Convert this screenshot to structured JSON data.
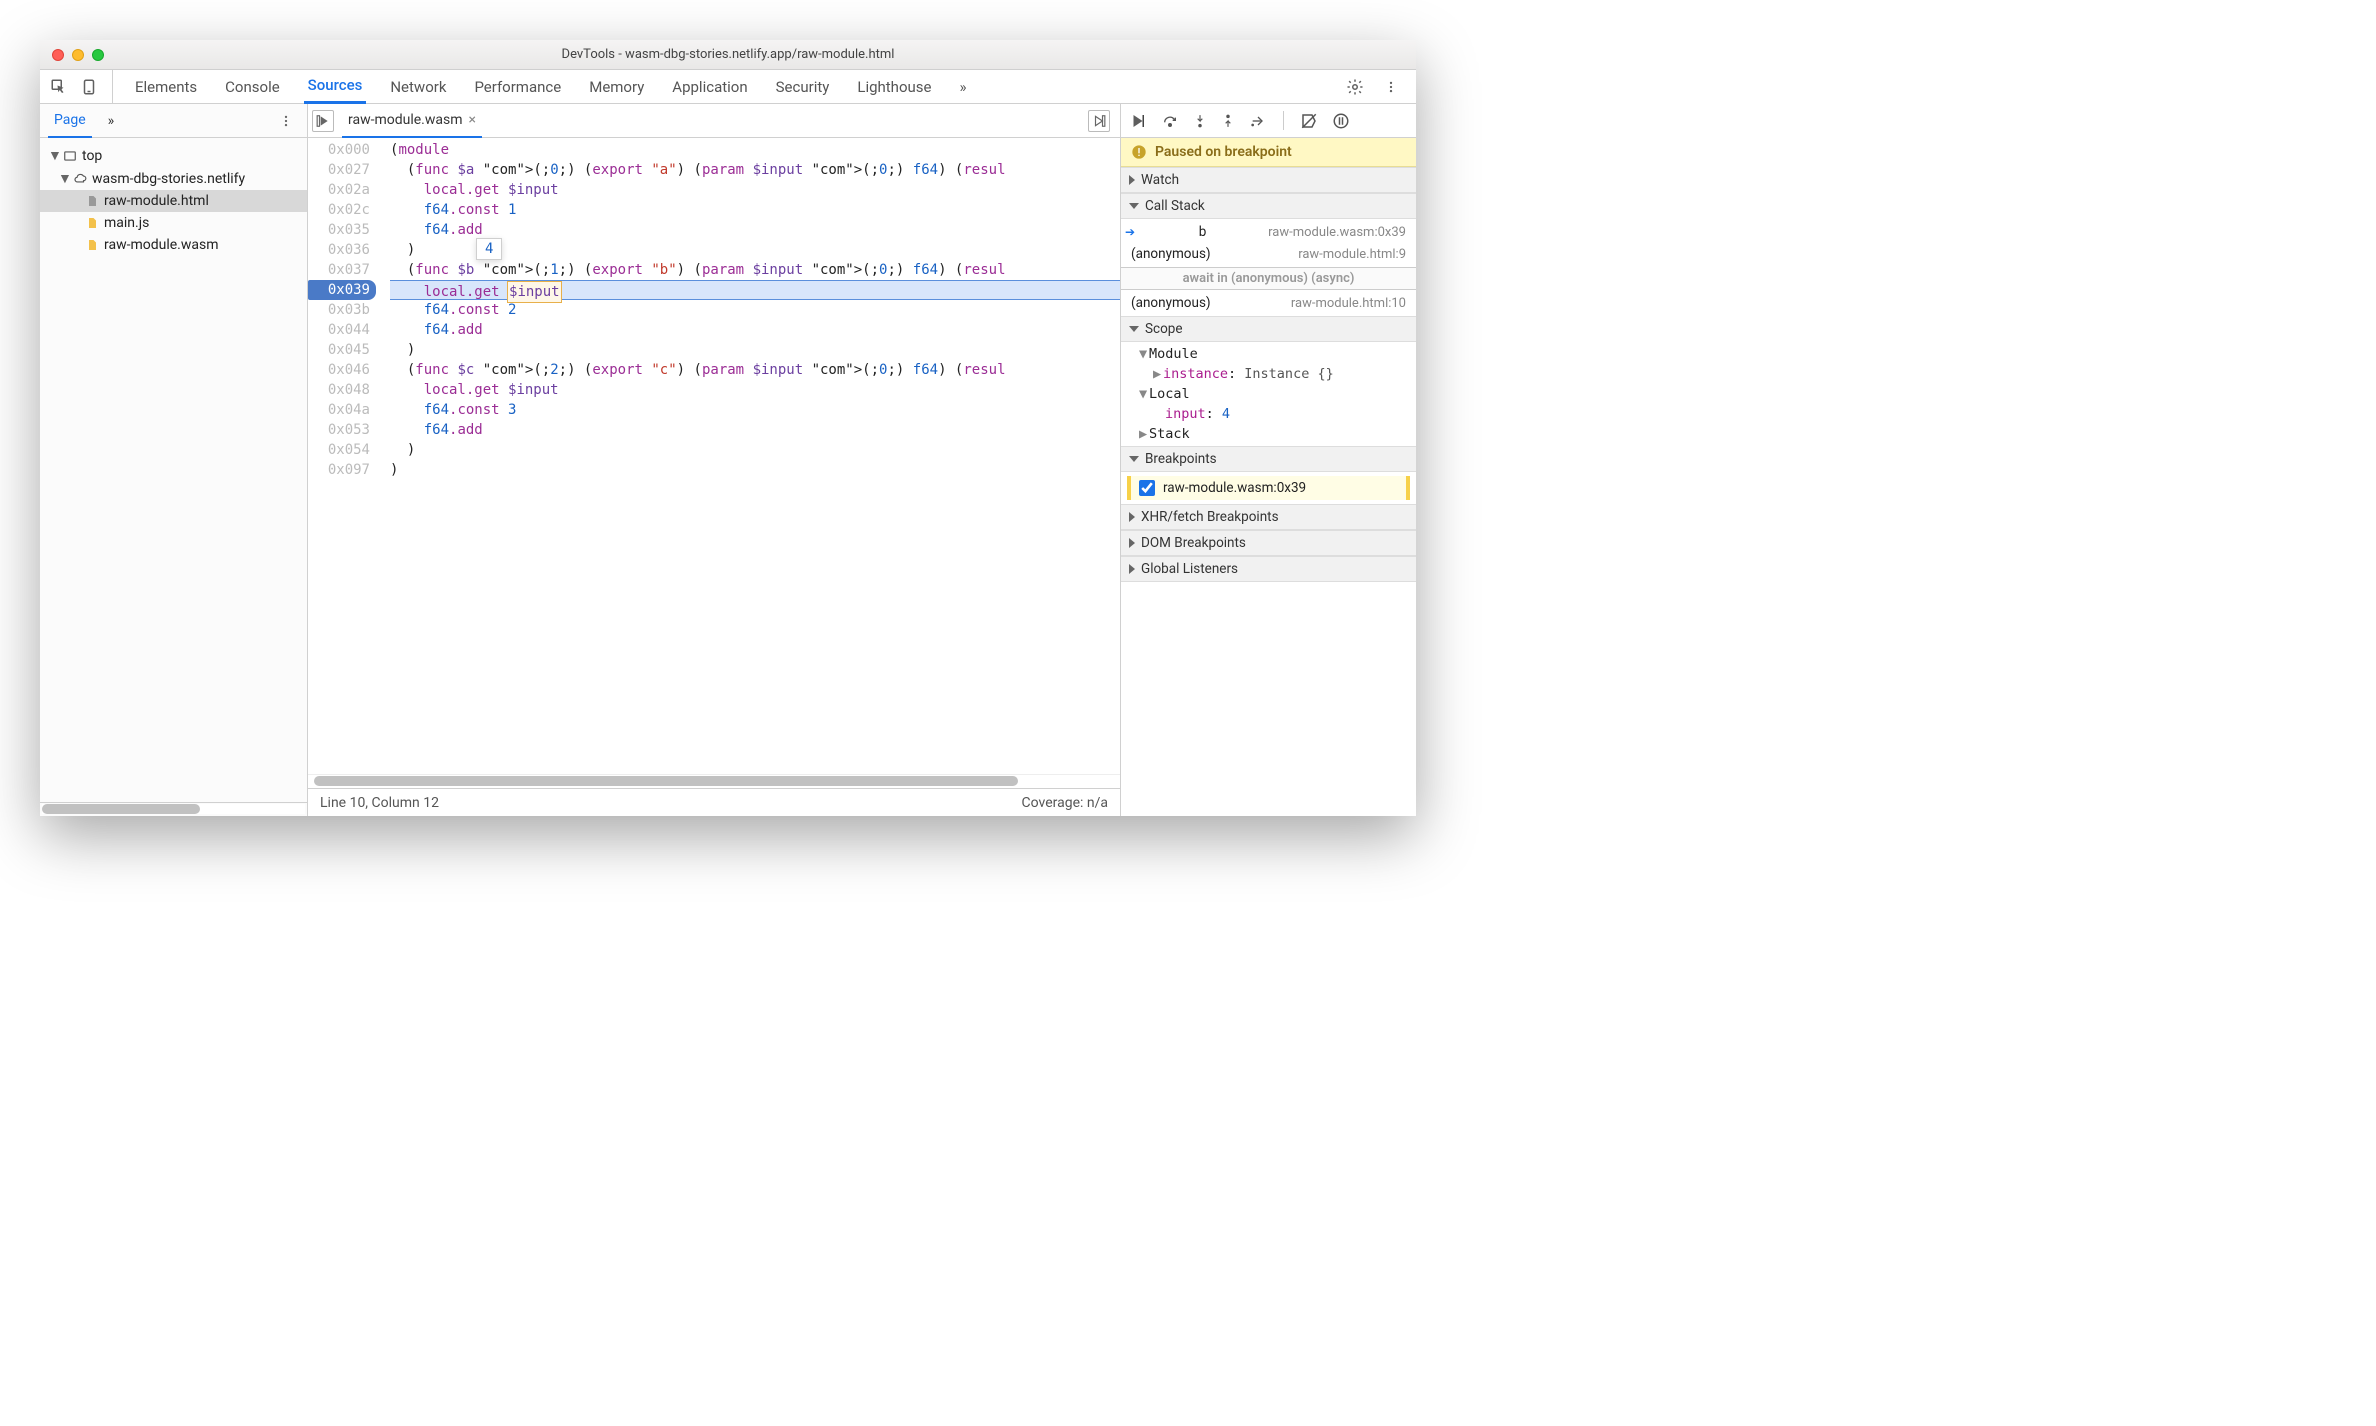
{
  "window": {
    "title": "DevTools - wasm-dbg-stories.netlify.app/raw-module.html"
  },
  "tabs": {
    "items": [
      "Elements",
      "Console",
      "Sources",
      "Network",
      "Performance",
      "Memory",
      "Application",
      "Security",
      "Lighthouse"
    ],
    "active": "Sources",
    "overflow": "»"
  },
  "sidebar": {
    "tabs": {
      "active": "Page",
      "overflow": "»"
    },
    "tree": {
      "top": "top",
      "domain": "wasm-dbg-stories.netlify",
      "files": [
        "raw-module.html",
        "main.js",
        "raw-module.wasm"
      ]
    }
  },
  "editor": {
    "open_file": "raw-module.wasm",
    "gutter": [
      "0x000",
      "0x027",
      "0x02a",
      "0x02c",
      "0x035",
      "0x036",
      "0x037",
      "0x039",
      "0x03b",
      "0x044",
      "0x045",
      "0x046",
      "0x048",
      "0x04a",
      "0x053",
      "0x054",
      "0x097"
    ],
    "breakpoint_line_index": 7,
    "hover_value": "4",
    "highlight_var": "$input",
    "lines": [
      {
        "t": "(module",
        "c": "kw"
      },
      {
        "raw": "  (func $a (;0;) (export \"a\") (param $input (;0;) f64) (resul"
      },
      {
        "raw": "    local.get $input"
      },
      {
        "raw": "    f64.const 1"
      },
      {
        "raw": "    f64.add"
      },
      {
        "raw": "  )"
      },
      {
        "raw": "  (func $b (;1;) (export \"b\") (param $input (;0;) f64) (resul"
      },
      {
        "raw": "    local.get $input",
        "hl": true
      },
      {
        "raw": "    f64.const 2"
      },
      {
        "raw": "    f64.add"
      },
      {
        "raw": "  )"
      },
      {
        "raw": "  (func $c (;2;) (export \"c\") (param $input (;0;) f64) (resul"
      },
      {
        "raw": "    local.get $input"
      },
      {
        "raw": "    f64.const 3"
      },
      {
        "raw": "    f64.add"
      },
      {
        "raw": "  )"
      },
      {
        "raw": ")"
      }
    ],
    "status": {
      "position": "Line 10, Column 12",
      "coverage": "Coverage: n/a"
    }
  },
  "debugger": {
    "banner": "Paused on breakpoint",
    "sections": {
      "watch": "Watch",
      "callstack": "Call Stack",
      "scope": "Scope",
      "breakpoints": "Breakpoints",
      "xhr": "XHR/fetch Breakpoints",
      "dom": "DOM Breakpoints",
      "global": "Global Listeners"
    },
    "callstack": [
      {
        "name": "b",
        "loc": "raw-module.wasm:0x39",
        "current": true
      },
      {
        "name": "(anonymous)",
        "loc": "raw-module.html:9"
      },
      {
        "await": "await in (anonymous) (async)"
      },
      {
        "name": "(anonymous)",
        "loc": "raw-module.html:10"
      }
    ],
    "scope": {
      "module": {
        "label": "Module",
        "prop": "instance",
        "val": "Instance {}"
      },
      "local": {
        "label": "Local",
        "prop": "input",
        "val": "4"
      },
      "stack": "Stack"
    },
    "breakpoints": [
      {
        "checked": true,
        "label": "raw-module.wasm:0x39"
      }
    ]
  }
}
